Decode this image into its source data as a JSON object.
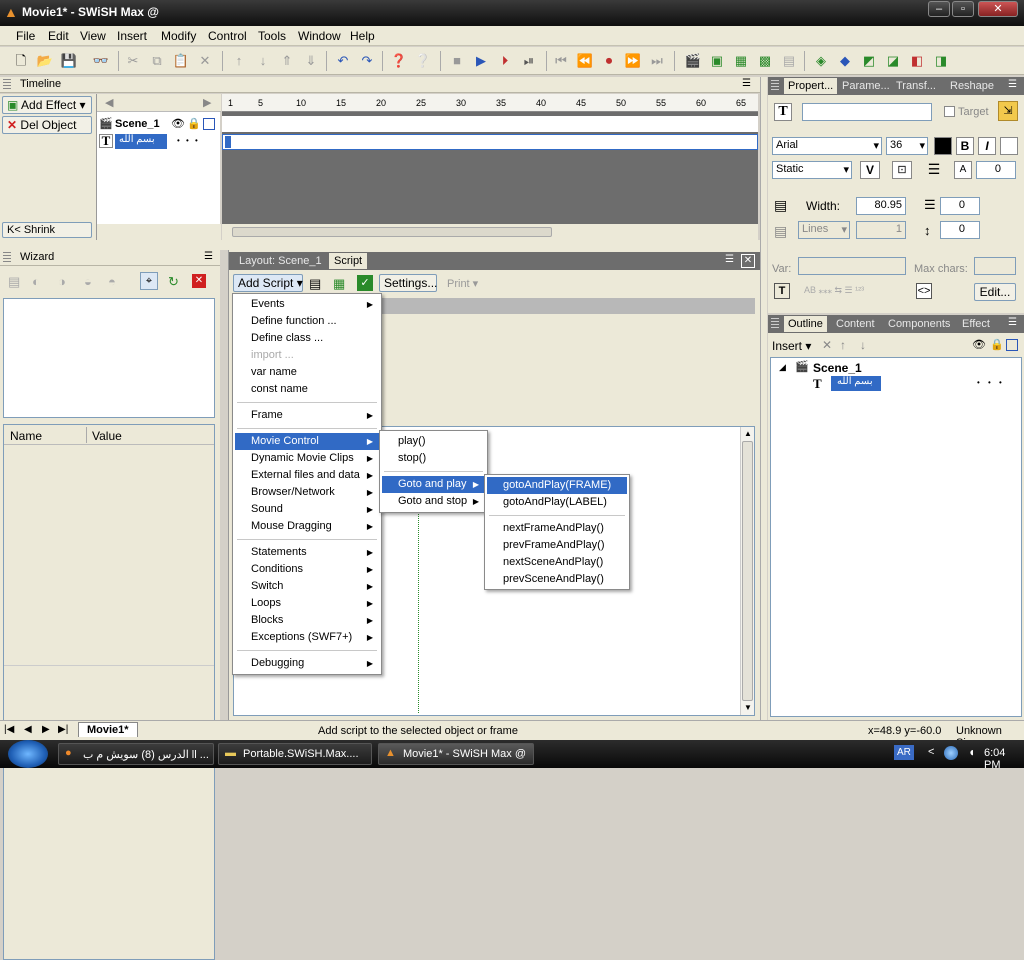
{
  "window": {
    "title": "Movie1* - SWiSH Max @"
  },
  "menubar": [
    "File",
    "Edit",
    "View",
    "Insert",
    "Modify",
    "Control",
    "Tools",
    "Window",
    "Help"
  ],
  "timeline": {
    "title": "Timeline",
    "add_effect": "Add Effect",
    "del_object": "Del Object",
    "shrink": "Shrink",
    "scene": "Scene_1",
    "object": "بسم الله",
    "object_dots": "• • •",
    "ruler": [
      "1",
      "5",
      "10",
      "15",
      "20",
      "25",
      "30",
      "35",
      "40",
      "45",
      "50",
      "55",
      "60",
      "65"
    ]
  },
  "wizard": {
    "title": "Wizard",
    "col_name": "Name",
    "col_value": "Value"
  },
  "script": {
    "tab_layout": "Layout: Scene_1",
    "tab_script": "Script",
    "add_script": "Add Script",
    "settings": "Settings...",
    "print": "Print"
  },
  "menu_main": [
    {
      "label": "Events",
      "sub": true
    },
    {
      "label": "Define function ..."
    },
    {
      "label": "Define class ..."
    },
    {
      "label": "import ...",
      "disabled": true
    },
    {
      "label": "var name"
    },
    {
      "label": "const name"
    },
    {
      "sep": true
    },
    {
      "label": "Frame",
      "sub": true
    },
    {
      "sep": true
    },
    {
      "label": "Movie Control",
      "sub": true,
      "selected": true
    },
    {
      "label": "Dynamic Movie Clips",
      "sub": true
    },
    {
      "label": "External files and data",
      "sub": true
    },
    {
      "label": "Browser/Network",
      "sub": true
    },
    {
      "label": "Sound",
      "sub": true
    },
    {
      "label": "Mouse Dragging",
      "sub": true
    },
    {
      "sep": true
    },
    {
      "label": "Statements",
      "sub": true
    },
    {
      "label": "Conditions",
      "sub": true
    },
    {
      "label": "Switch",
      "sub": true
    },
    {
      "label": "Loops",
      "sub": true
    },
    {
      "label": "Blocks",
      "sub": true
    },
    {
      "label": "Exceptions (SWF7+)",
      "sub": true
    },
    {
      "sep": true
    },
    {
      "label": "Debugging",
      "sub": true
    }
  ],
  "menu_movie": [
    {
      "label": "play()"
    },
    {
      "label": "stop()"
    },
    {
      "sep": true
    },
    {
      "label": "Goto and play",
      "sub": true,
      "selected": true
    },
    {
      "label": "Goto and stop",
      "sub": true
    }
  ],
  "menu_goto": [
    {
      "label": "gotoAndPlay(FRAME)",
      "selected": true
    },
    {
      "label": "gotoAndPlay(LABEL)"
    },
    {
      "sep": true
    },
    {
      "label": "nextFrameAndPlay()"
    },
    {
      "label": "prevFrameAndPlay()"
    },
    {
      "label": "nextSceneAndPlay()"
    },
    {
      "label": "prevSceneAndPlay()"
    }
  ],
  "properties": {
    "tabs": [
      "Propert...",
      "Parame...",
      "Transf...",
      "Reshape"
    ],
    "target": "Target",
    "font": "Arial",
    "size": "36",
    "text_type": "Static",
    "spacing": "0",
    "width_label": "Width:",
    "width_value": "80.95",
    "indent": "0",
    "lines": "Lines",
    "lines_value": "1",
    "leading": "0",
    "var_label": "Var:",
    "maxchars_label": "Max chars:",
    "edit": "Edit...",
    "bold": "B",
    "italic": "I",
    "v": "V"
  },
  "outline": {
    "tabs": [
      "Outline",
      "Content",
      "Components",
      "Effect"
    ],
    "insert": "Insert",
    "scene": "Scene_1",
    "object": "بسم الله",
    "object_dots": "• • •"
  },
  "statusbar": {
    "scene_tab": "Movie1*",
    "message": "Add script to the selected object or frame",
    "coords": "x=48.9 y=-60.0",
    "size": "Unknown Size"
  },
  "taskbar": {
    "items": [
      "الدرس (8) سويش م ب ll ...",
      "Portable.SWiSH.Max....",
      "Movie1* - SWiSH Max @"
    ],
    "lang": "AR",
    "time": "6:04 PM"
  }
}
